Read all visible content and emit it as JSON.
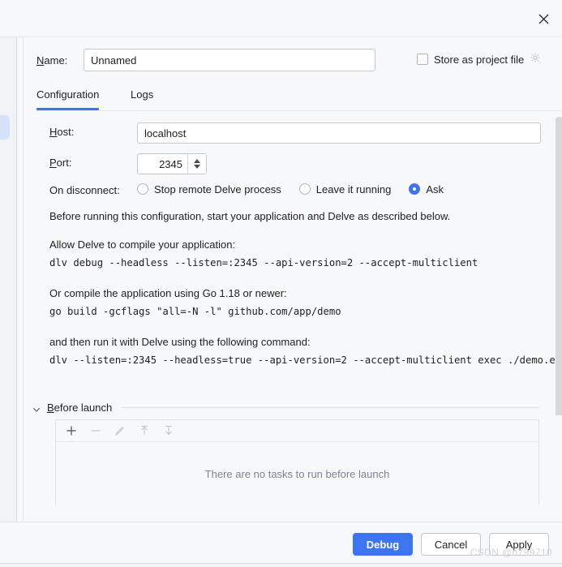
{
  "window": {
    "close_icon": "close-icon"
  },
  "name_row": {
    "label": "Name:",
    "mnemonic": "N",
    "label_rest": "ame:",
    "value": "Unnamed",
    "placeholder": "Unnamed",
    "store_checkbox_label": "Store as project file",
    "store_checked": false,
    "gear_icon": "gear-icon"
  },
  "tabs": [
    {
      "label": "Configuration",
      "selected": true
    },
    {
      "label": "Logs",
      "selected": false
    }
  ],
  "form": {
    "host_label": "Host:",
    "host_mnemonic": "H",
    "host_label_rest": "ost:",
    "host_value": "localhost",
    "port_label": "Port:",
    "port_mnemonic": "P",
    "port_label_rest": "ort:",
    "port_value": "2345",
    "on_disconnect_label": "On disconnect:",
    "on_disconnect_options": [
      {
        "label": "Stop remote Delve process",
        "selected": false
      },
      {
        "label": "Leave it running",
        "selected": false
      },
      {
        "label": "Ask",
        "selected": true
      }
    ]
  },
  "instructions": {
    "intro": "Before running this configuration, start your application and Delve as described below.",
    "heading_1": "Allow Delve to compile your application:",
    "command_1": "dlv debug --headless --listen=:2345 --api-version=2 --accept-multiclient",
    "heading_2": "Or compile the application using Go 1.18 or newer:",
    "command_2": "go build -gcflags \"all=-N -l\" github.com/app/demo",
    "heading_3": "and then run it with Delve using the following command:",
    "command_3": "dlv --listen=:2345 --headless=true --api-version=2 --accept-multiclient exec ./demo.e›"
  },
  "before_launch": {
    "title": "Before launch",
    "mnemonic": "B",
    "title_rest": "efore launch",
    "expanded": true,
    "chevron_icon": "chevron-down-icon",
    "toolbar": [
      {
        "name": "add-task-button",
        "icon": "plus-icon",
        "enabled": true
      },
      {
        "name": "remove-task-button",
        "icon": "minus-icon",
        "enabled": false
      },
      {
        "name": "edit-task-button",
        "icon": "pencil-icon",
        "enabled": false
      },
      {
        "name": "move-up-button",
        "icon": "arrow-up-icon",
        "enabled": false
      },
      {
        "name": "move-down-button",
        "icon": "arrow-down-icon",
        "enabled": false
      }
    ],
    "empty_text": "There are no tasks to run before launch"
  },
  "footer": {
    "debug_label": "Debug",
    "cancel_label": "Cancel",
    "apply_label": "Apply"
  },
  "watermark": "CSDN @h799710",
  "colors": {
    "accent": "#3d74f0",
    "background": "#f7f8fa",
    "field_background": "#ffffff",
    "border": "#c4c7cc",
    "muted_text": "#7d8392"
  }
}
